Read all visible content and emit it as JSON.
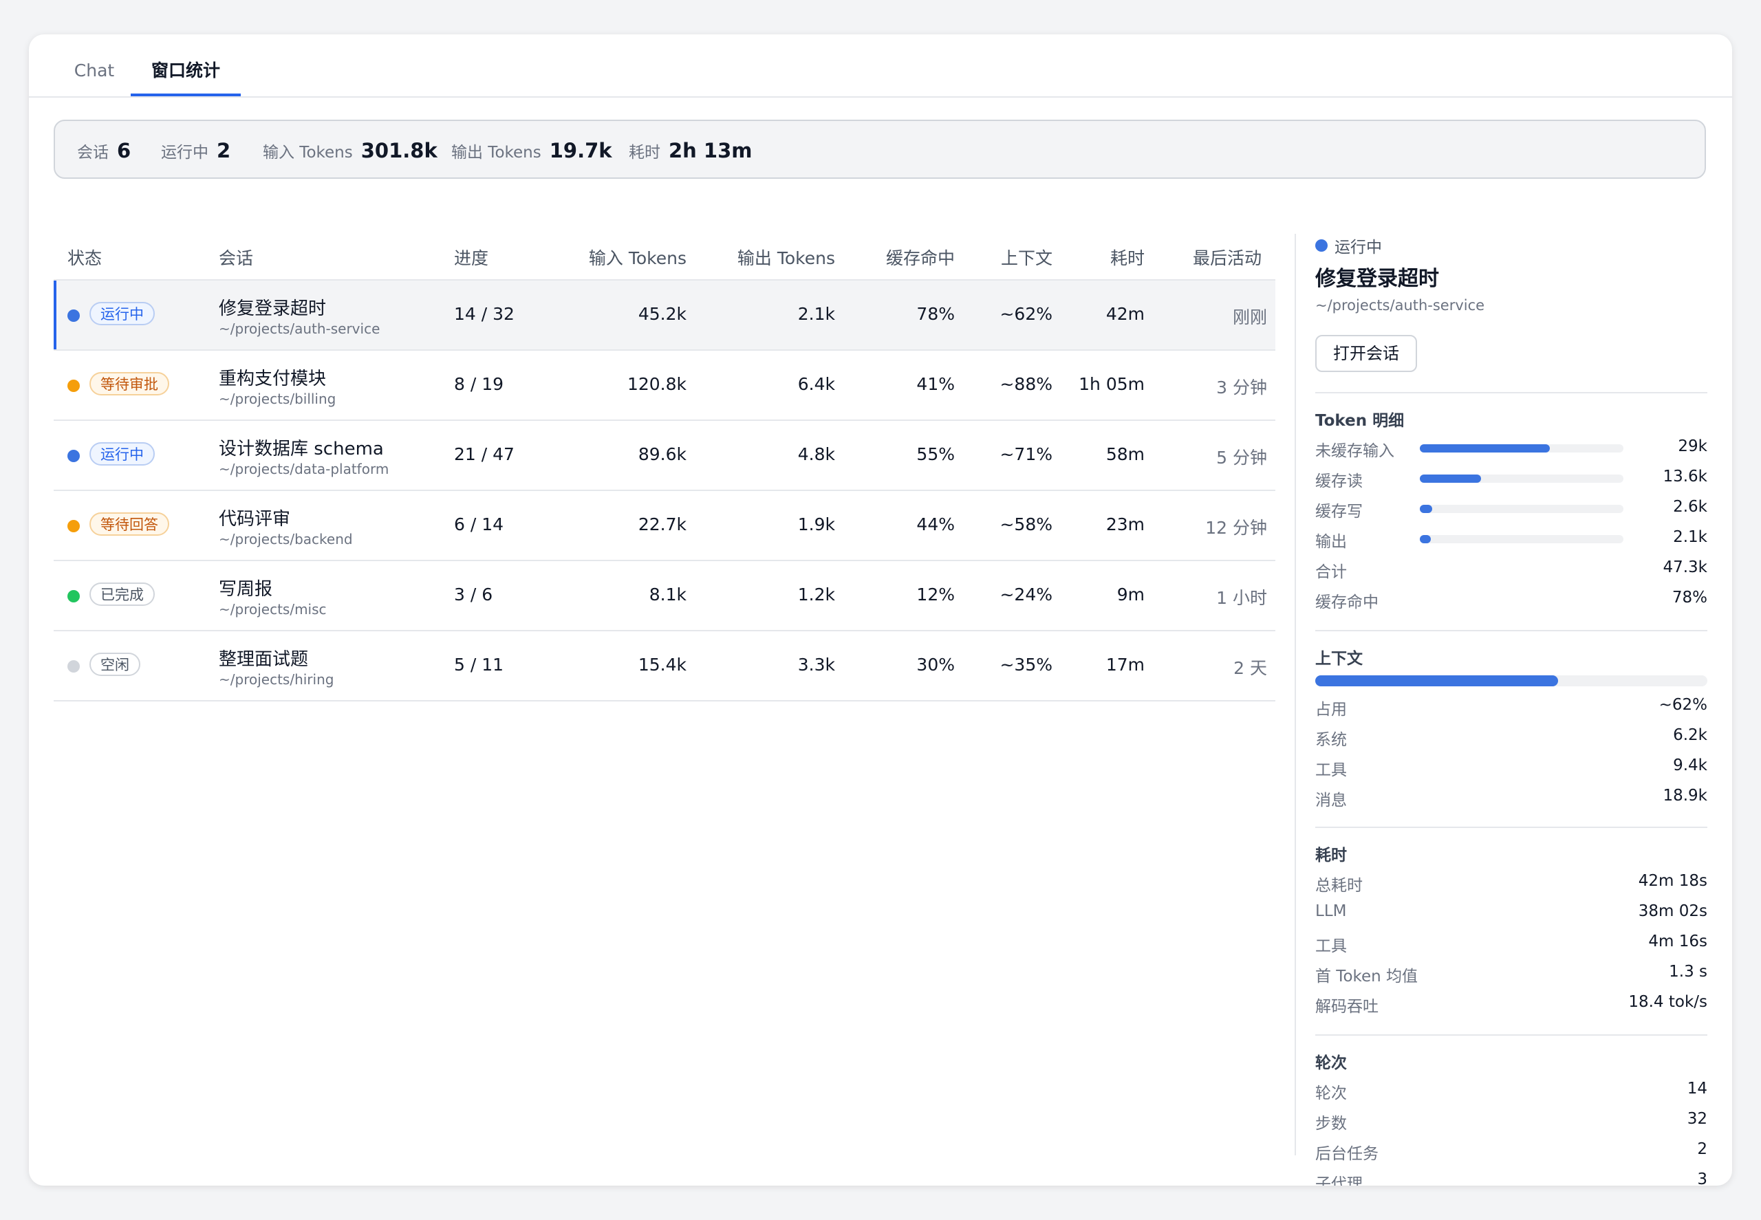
{
  "tabs": [
    "Chat",
    "窗口统计"
  ],
  "summary": [
    {
      "label": "会话",
      "value": "6"
    },
    {
      "label": "运行中",
      "value": "2"
    },
    {
      "label": "输入 Tokens",
      "value": "301.8k"
    },
    {
      "label": "输出 Tokens",
      "value": "19.7k"
    },
    {
      "label": "耗时",
      "value": "2h 13m"
    }
  ],
  "table": {
    "headers": [
      "状态",
      "会话",
      "进度",
      "输入 Tokens",
      "输出 Tokens",
      "缓存命中",
      "上下文",
      "耗时",
      "最后活动"
    ],
    "rows": [
      {
        "status": "运行中",
        "status_kind": "running",
        "name": "修复登录超时",
        "path": "~/projects/auth-service",
        "progress": "14 / 32",
        "input": "45.2k",
        "output": "2.1k",
        "cache": "78%",
        "context": "~62%",
        "time": "42m",
        "last": "刚刚"
      },
      {
        "status": "等待审批",
        "status_kind": "waiting",
        "name": "重构支付模块",
        "path": "~/projects/billing",
        "progress": "8 / 19",
        "input": "120.8k",
        "output": "6.4k",
        "cache": "41%",
        "context": "~88%",
        "time": "1h 05m",
        "last": "3 分钟"
      },
      {
        "status": "运行中",
        "status_kind": "running",
        "name": "设计数据库 schema",
        "path": "~/projects/data-platform",
        "progress": "21 / 47",
        "input": "89.6k",
        "output": "4.8k",
        "cache": "55%",
        "context": "~71%",
        "time": "58m",
        "last": "5 分钟"
      },
      {
        "status": "等待回答",
        "status_kind": "waiting",
        "name": "代码评审",
        "path": "~/projects/backend",
        "progress": "6 / 14",
        "input": "22.7k",
        "output": "1.9k",
        "cache": "44%",
        "context": "~58%",
        "time": "23m",
        "last": "12 分钟"
      },
      {
        "status": "已完成",
        "status_kind": "done",
        "name": "写周报",
        "path": "~/projects/misc",
        "progress": "3 / 6",
        "input": "8.1k",
        "output": "1.2k",
        "cache": "12%",
        "context": "~24%",
        "time": "9m",
        "last": "1 小时"
      },
      {
        "status": "空闲",
        "status_kind": "idle",
        "name": "整理面试题",
        "path": "~/projects/hiring",
        "progress": "5 / 11",
        "input": "15.4k",
        "output": "3.3k",
        "cache": "30%",
        "context": "~35%",
        "time": "17m",
        "last": "2 天"
      }
    ]
  },
  "status_colors": {
    "running": {
      "dot": "#3b74e0",
      "text": "#2563eb",
      "bg": "#eff5ff",
      "border": "#b9cdf3"
    },
    "waiting": {
      "dot": "#f59e0b",
      "text": "#c2570c",
      "bg": "#fff7ea",
      "border": "#f6d19a"
    },
    "done": {
      "dot": "#22c55e",
      "text": "#4b5563",
      "bg": "#ffffff",
      "border": "#d1d5db"
    },
    "idle": {
      "dot": "#d1d5db",
      "text": "#4b5563",
      "bg": "#ffffff",
      "border": "#d1d5db"
    }
  },
  "detail": {
    "status": "运行中",
    "title": "修复登录超时",
    "path": "~/projects/auth-service",
    "open_button": "打开会话",
    "token_section": {
      "title": "Token 明细",
      "bars": [
        {
          "label": "未缓存输入",
          "value": "29k",
          "fraction": 0.64
        },
        {
          "label": "缓存读",
          "value": "13.6k",
          "fraction": 0.3
        },
        {
          "label": "缓存写",
          "value": "2.6k",
          "fraction": 0.06
        },
        {
          "label": "输出",
          "value": "2.1k",
          "fraction": 0.045
        }
      ],
      "rows": [
        {
          "label": "合计",
          "value": "47.3k"
        },
        {
          "label": "缓存命中",
          "value": "78%"
        }
      ]
    },
    "context_section": {
      "title": "上下文",
      "fraction": 0.62,
      "rows": [
        {
          "label": "占用",
          "value": "~62%"
        },
        {
          "label": "系统",
          "value": "6.2k"
        },
        {
          "label": "工具",
          "value": "9.4k"
        },
        {
          "label": "消息",
          "value": "18.9k"
        }
      ]
    },
    "time_section": {
      "title": "耗时",
      "rows": [
        {
          "label": "总耗时",
          "value": "42m 18s"
        },
        {
          "label": "LLM",
          "value": "38m 02s"
        },
        {
          "label": "工具",
          "value": "4m 16s"
        },
        {
          "label": "首 Token 均值",
          "value": "1.3 s"
        },
        {
          "label": "解码吞吐",
          "value": "18.4 tok/s"
        }
      ]
    },
    "turns_section": {
      "title": "轮次",
      "rows": [
        {
          "label": "轮次",
          "value": "14"
        },
        {
          "label": "步数",
          "value": "32"
        },
        {
          "label": "后台任务",
          "value": "2"
        },
        {
          "label": "子代理",
          "value": "3"
        }
      ]
    }
  }
}
